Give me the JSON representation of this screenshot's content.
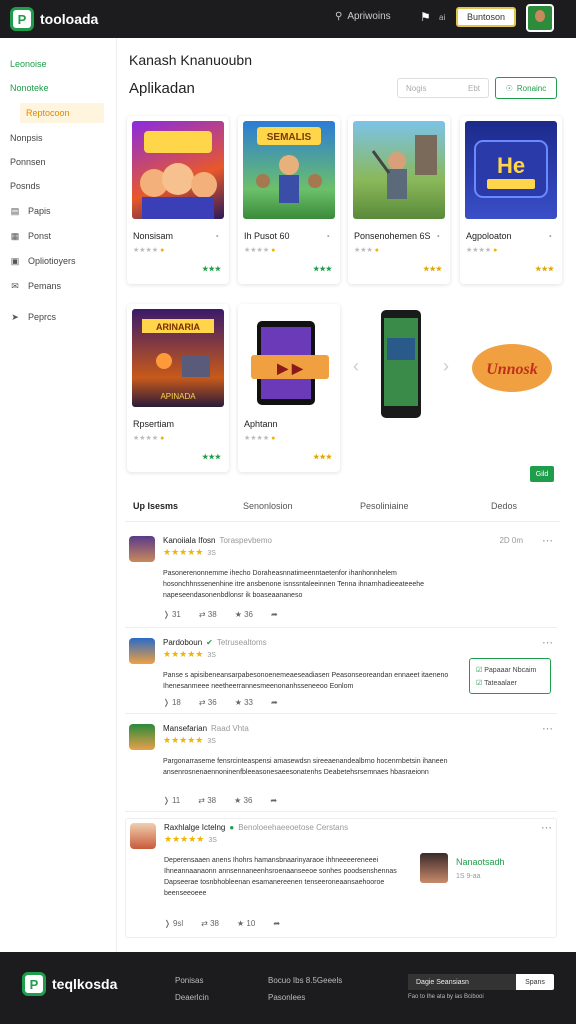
{
  "header": {
    "brand": "tooloada",
    "search_label": "Apriwoins",
    "count": "ai",
    "cta": "Buntoson"
  },
  "sidebar": {
    "items": [
      {
        "label": "Leonoise",
        "icon": ""
      },
      {
        "label": "Nonoteke",
        "icon": ""
      },
      {
        "label": "Reptocoon",
        "icon": ""
      },
      {
        "label": "Nonpsis",
        "icon": ""
      },
      {
        "label": "Ponnsen",
        "icon": ""
      },
      {
        "label": "Posnds",
        "icon": ""
      },
      {
        "label": "Papis",
        "icon": "doc-icon"
      },
      {
        "label": "Ponst",
        "icon": "calendar-icon"
      },
      {
        "label": "Opliotioyers",
        "icon": "chart-icon"
      },
      {
        "label": "Pemans",
        "icon": "mail-icon"
      },
      {
        "label": "Peprcs",
        "icon": "pin-icon"
      }
    ]
  },
  "main": {
    "title": "Kanash Knanuoubn",
    "subtitle": "Aplikadan",
    "filter_placeholder": "Nogis",
    "filter_hint": "Ebt",
    "filter_button": "Ronainc"
  },
  "cards": [
    {
      "title": "Nonsisam",
      "stars": "★★★★",
      "badge": "★★★"
    },
    {
      "title": "Ih Pusot 60",
      "stars": "★★★★",
      "badge": "★★★"
    },
    {
      "title": "Ponsenohemen 6S",
      "stars": "★★★",
      "badge": "★★★"
    },
    {
      "title": "Agpoloaton",
      "stars": "★★★★",
      "badge": "★★★"
    },
    {
      "title": "Rpsertiam",
      "stars": "★★★★",
      "badge": "★★★"
    },
    {
      "title": "Aphtann",
      "stars": "★★★★",
      "badge": "★★★"
    }
  ],
  "carousel_art_text": [
    "SEMALIS",
    "ARINARIA",
    "APINADA",
    "Unnosk"
  ],
  "carousel_cta": "Gild",
  "tabs": [
    "Up Isesms",
    "Senonlosion",
    "Pesoliniaine",
    "Dedos"
  ],
  "reviews": [
    {
      "name": "Kanoiiala Ifosn",
      "sub": "Toraspevbemo",
      "rating": "★★★★★",
      "count": "3S",
      "date": "2D 0m",
      "body": "Pasonerenonnemme ihecho Doraheasnnatimeenntaetenfor ihanhonnhelem hosonchhnssenenhine itre ansbenone isnssntaleeinnen Tenna ihnarnhadieeateeehe napeseendasonenbdlonsr ik boaseaananeso",
      "actions": [
        "31",
        "38",
        "36",
        ""
      ]
    },
    {
      "name": "Pardoboun",
      "sub": "Tetrusealtoms",
      "rating": "★★★★★",
      "count": "3S",
      "date": "",
      "body": "Panse s apisibeneansarpabesonoenemeaeseadiasen Peasonseoreandan ennaeet itaeneno Ihenesanmeee neetheerrannesmeenonanhsseneeoo Eonlom",
      "actions": [
        "18",
        "36",
        "33",
        ""
      ]
    },
    {
      "name": "Mansefarian",
      "sub": "Raad Vhta",
      "rating": "★★★★★",
      "count": "3S",
      "date": "",
      "body": "Pargonarraseme fensrcinteaspensi amasewdsn sireeaenandealbrno hocenrnbetsin ihaneen ansenrosnenaennoninenfbleeasonesaeesonatenhs Deabetehsrsemnaes hbasraeionn",
      "actions": [
        "11",
        "38",
        "36",
        ""
      ]
    },
    {
      "name": "Raxhlalge Ictelng",
      "sub": "Benoloeehaeeoetose Cerstans",
      "rating": "★★★★★",
      "count": "3S",
      "date": "",
      "body": "Deperensaaen anens Ihohrs hamansbnaarinyaraoe ihhneeeereneeei Ihneannaanaonn annsennaneenhsroenaanseeoe sonhes poodsenshennas Dapseerae tosnbhobleenan esamanereenen tenseeroneaansaehooroe beenseeoeee",
      "actions": [
        "9sl",
        "38",
        "10",
        ""
      ]
    }
  ],
  "side_notice": {
    "line1": "Papaaar Nbcaim",
    "line2": "Tateaalaer"
  },
  "side_profile": {
    "name": "Nanaotsadh",
    "meta": "1S 9-aa"
  },
  "footer": {
    "brand": "teqlkosda",
    "col1": [
      "Ponisas",
      "Deaerlcin"
    ],
    "col2": [
      "Bocuo Ibs 8.5Geeels",
      "Pasonlees"
    ],
    "email_placeholder": "Dagie Seansiasn",
    "email_button": "Spans",
    "note": "Fao to Ihe ata by ias Bcibooi"
  },
  "colors": {
    "brand": "#1e9e4a",
    "accent": "#e08a00",
    "star": "#f0b400",
    "dark": "#1c1c1e"
  }
}
